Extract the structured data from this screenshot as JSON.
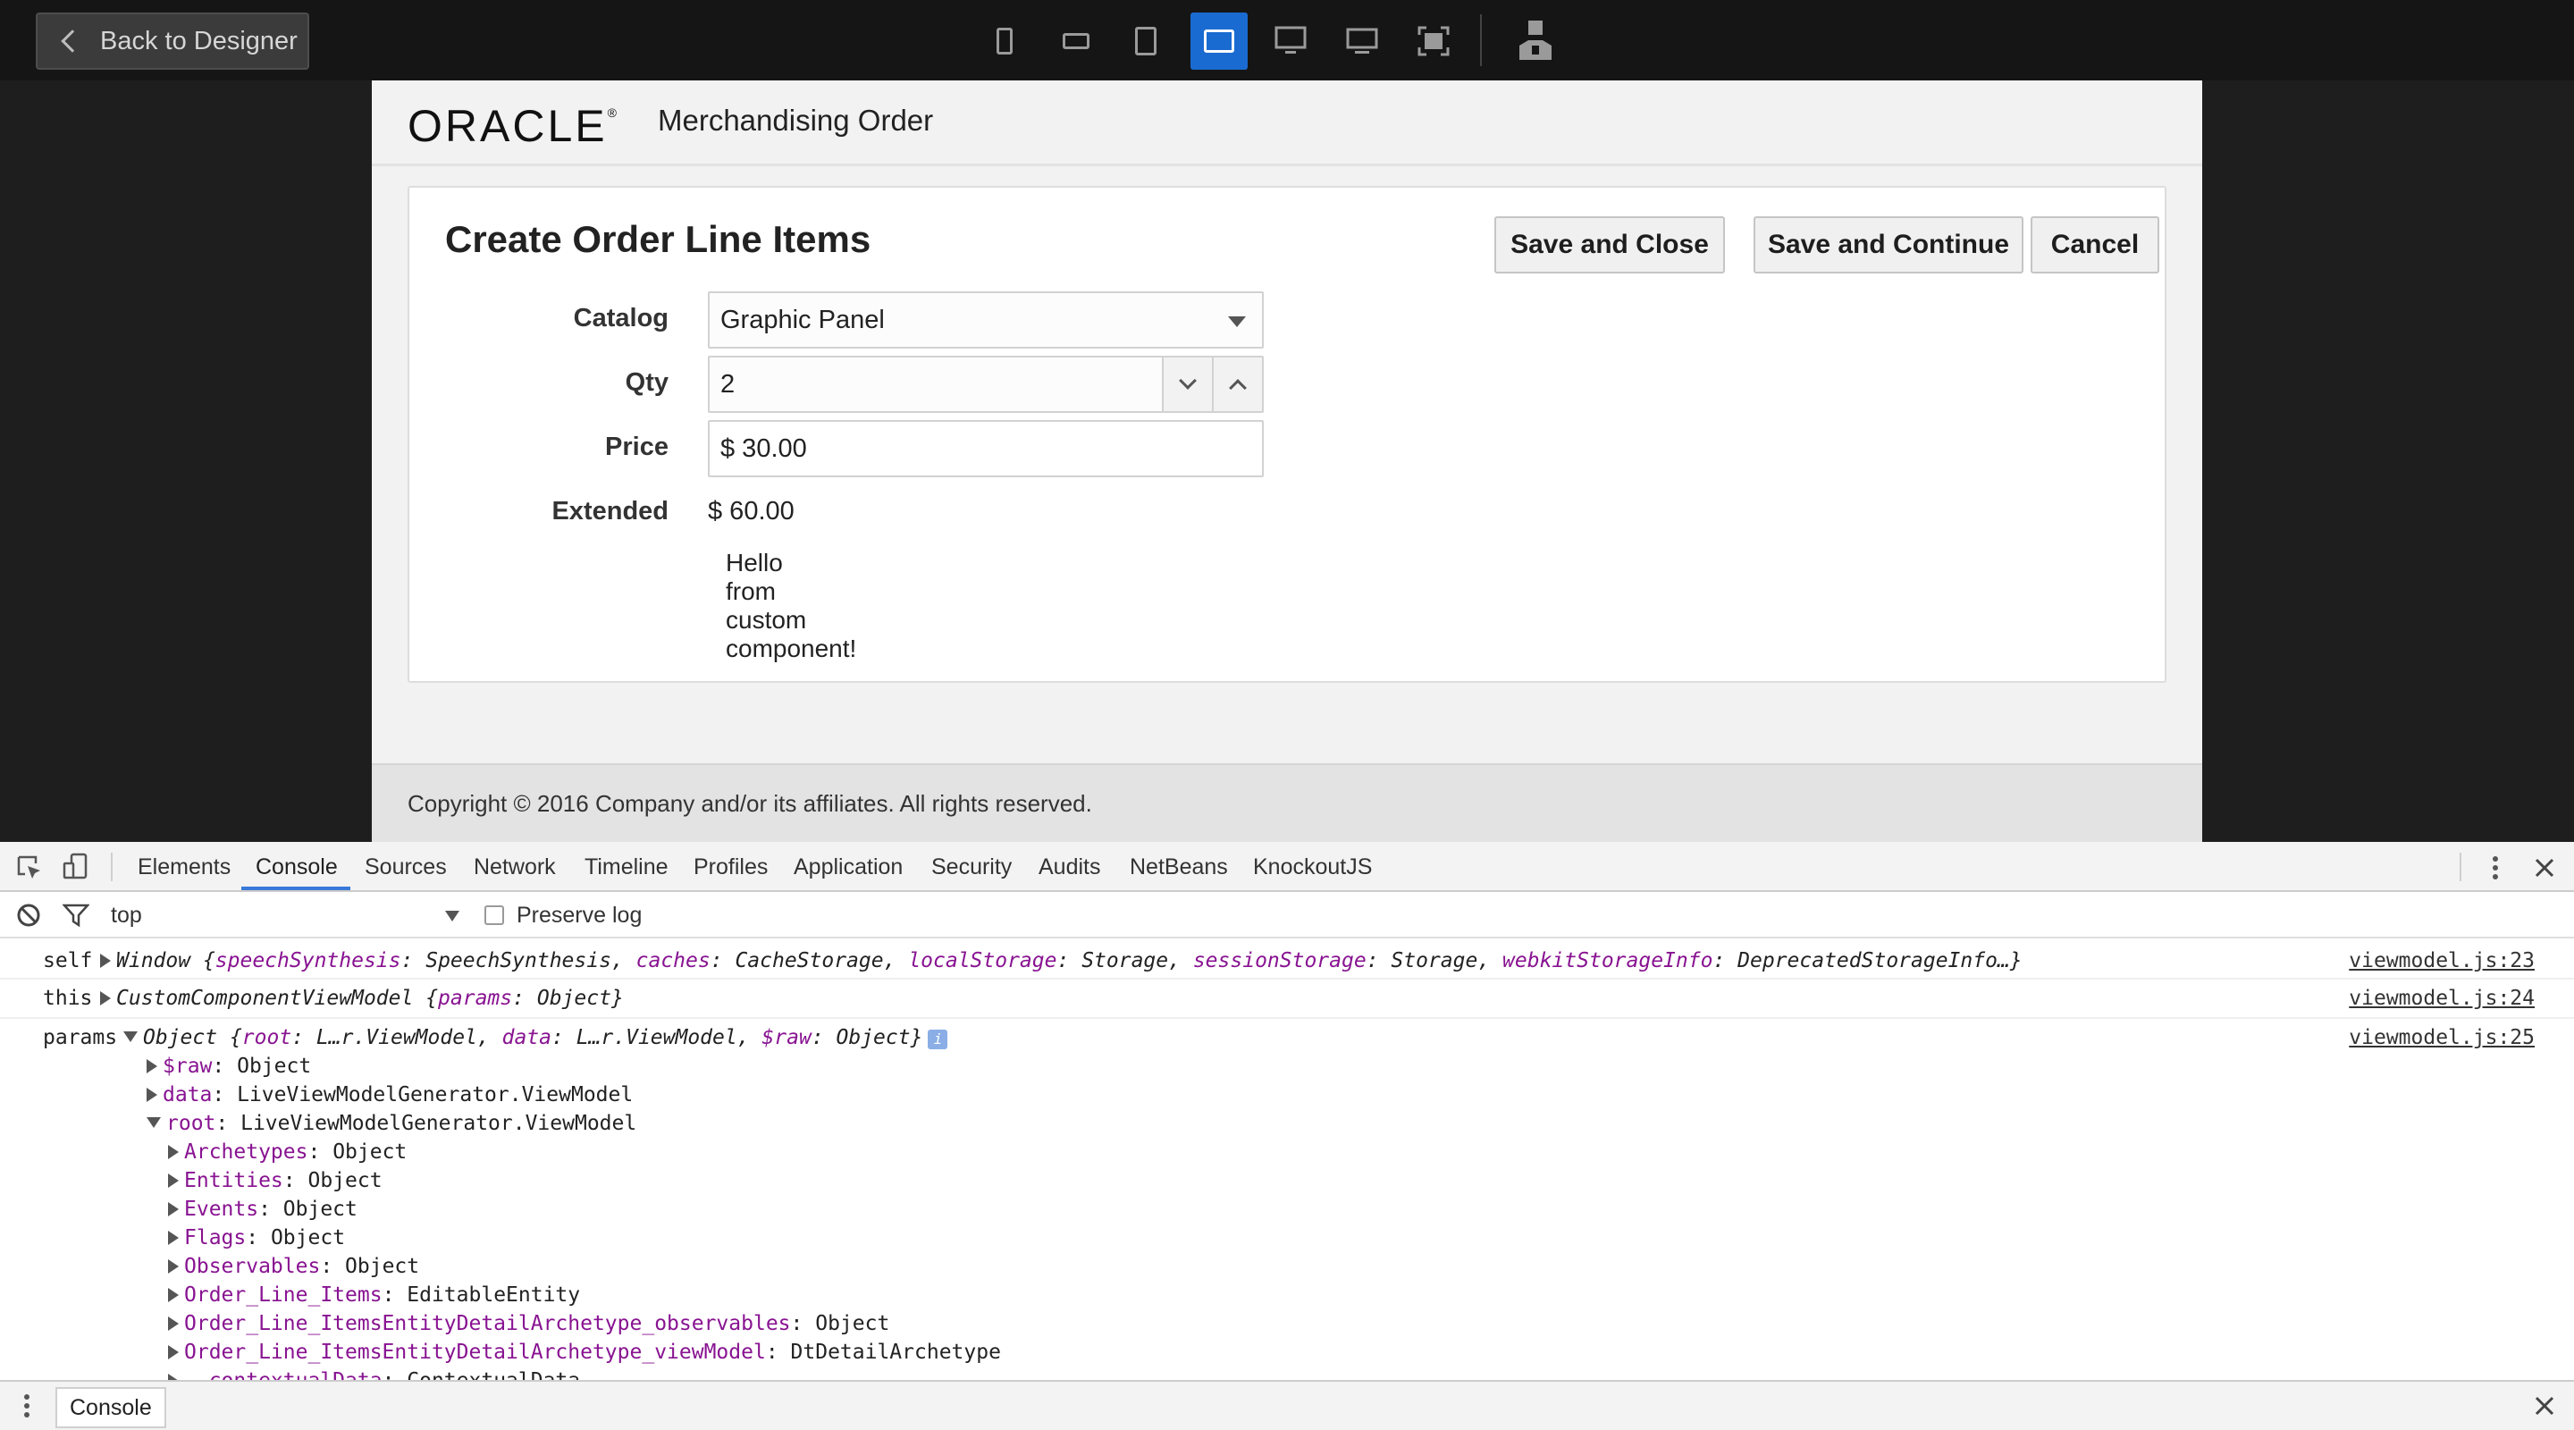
{
  "toolbar": {
    "back_label": "Back to Designer",
    "devices": [
      "phone-portrait-icon",
      "phone-landscape-icon",
      "tablet-portrait-icon",
      "tablet-landscape-icon",
      "monitor-icon",
      "desktop-icon",
      "fullscreen-icon",
      "user-icon"
    ],
    "active_device": "tablet-landscape-icon",
    "accent_color": "#1a6bd1"
  },
  "app": {
    "logo_text": "ORACLE",
    "logo_mark": "®",
    "title": "Merchandising Order",
    "form": {
      "title": "Create Order Line Items",
      "buttons": {
        "save_close": "Save and Close",
        "save_continue": "Save and Continue",
        "cancel": "Cancel"
      },
      "catalog": {
        "label": "Catalog",
        "value": "Graphic Panel"
      },
      "qty": {
        "label": "Qty",
        "value": "2"
      },
      "price": {
        "label": "Price",
        "value": "$ 30.00"
      },
      "extended": {
        "label": "Extended",
        "value": "$ 60.00"
      },
      "custom_lines": [
        "Hello",
        "from",
        "custom",
        "component!"
      ]
    },
    "footer": "Copyright © 2016 Company and/or its affiliates. All rights reserved."
  },
  "devtools": {
    "tabs": [
      "Elements",
      "Console",
      "Sources",
      "Network",
      "Timeline",
      "Profiles",
      "Application",
      "Security",
      "Audits",
      "NetBeans",
      "KnockoutJS"
    ],
    "active_tab": "Console",
    "filter_context": "top",
    "preserve_log_label": "Preserve log",
    "preserve_log_checked": false,
    "logs": {
      "self": {
        "label": "self",
        "type": "Window",
        "props": [
          {
            "k": "speechSynthesis",
            "v": "SpeechSynthesis"
          },
          {
            "k": "caches",
            "v": "CacheStorage"
          },
          {
            "k": "localStorage",
            "v": "Storage"
          },
          {
            "k": "sessionStorage",
            "v": "Storage"
          },
          {
            "k": "webkitStorageInfo",
            "v": "DeprecatedStorageInfo…"
          }
        ],
        "source": "viewmodel.js:23"
      },
      "this": {
        "label": "this",
        "type": "CustomComponentViewModel",
        "props": [
          {
            "k": "params",
            "v": "Object"
          }
        ],
        "source": "viewmodel.js:24"
      },
      "params": {
        "label": "params",
        "type": "Object",
        "props": [
          {
            "k": "root",
            "v": "L…r.ViewModel"
          },
          {
            "k": "data",
            "v": "L…r.ViewModel"
          },
          {
            "k": "$raw",
            "v": "Object"
          }
        ],
        "source": "viewmodel.js:25"
      }
    },
    "tree": {
      "raw": {
        "k": "$raw",
        "v": "Object"
      },
      "data": {
        "k": "data",
        "v": "LiveViewModelGenerator.ViewModel"
      },
      "root": {
        "k": "root",
        "v": "LiveViewModelGenerator.ViewModel"
      },
      "children": [
        {
          "k": "Archetypes",
          "v": "Object"
        },
        {
          "k": "Entities",
          "v": "Object"
        },
        {
          "k": "Events",
          "v": "Object"
        },
        {
          "k": "Flags",
          "v": "Object"
        },
        {
          "k": "Observables",
          "v": "Object"
        },
        {
          "k": "Order_Line_Items",
          "v": "EditableEntity"
        },
        {
          "k": "Order_Line_ItemsEntityDetailArchetype_observables",
          "v": "Object"
        },
        {
          "k": "Order_Line_ItemsEntityDetailArchetype_viewModel",
          "v": "DtDetailArchetype"
        },
        {
          "k": "__contextualData",
          "v": "ContextualData"
        }
      ]
    },
    "drawer_tab": "Console"
  }
}
